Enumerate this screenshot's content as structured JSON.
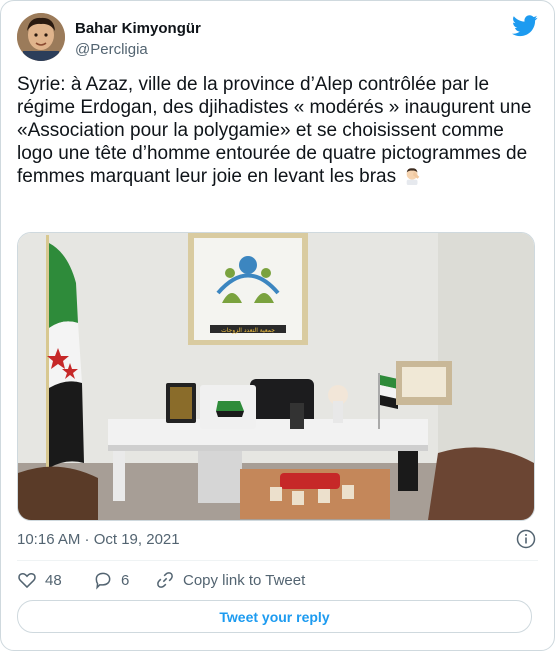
{
  "author": {
    "display_name": "Bahar Kimyongür",
    "handle": "@Percligia"
  },
  "tweet": {
    "text": "Syrie: à Azaz, ville de la province d’Alep contrôlée par le régime Erdogan, des djihadistes « modérés » inaugurent une «Association pour la polygamie» et se choisissent comme logo une tête d’homme entourée de quatre pictogrammes de femmes marquant leur joie en levant les bras",
    "emoji": "face-palm-emoji",
    "sign_text": "جمعية التعدد الزوجات",
    "timestamp": "10:16 AM · Oct 19, 2021"
  },
  "actions": {
    "likes": "48",
    "replies": "6",
    "copy_link": "Copy link to Tweet"
  },
  "reply_button": "Tweet your reply",
  "colors": {
    "accent": "#1d9bf0",
    "secondary_text": "#536471",
    "border": "#cfd9de"
  }
}
